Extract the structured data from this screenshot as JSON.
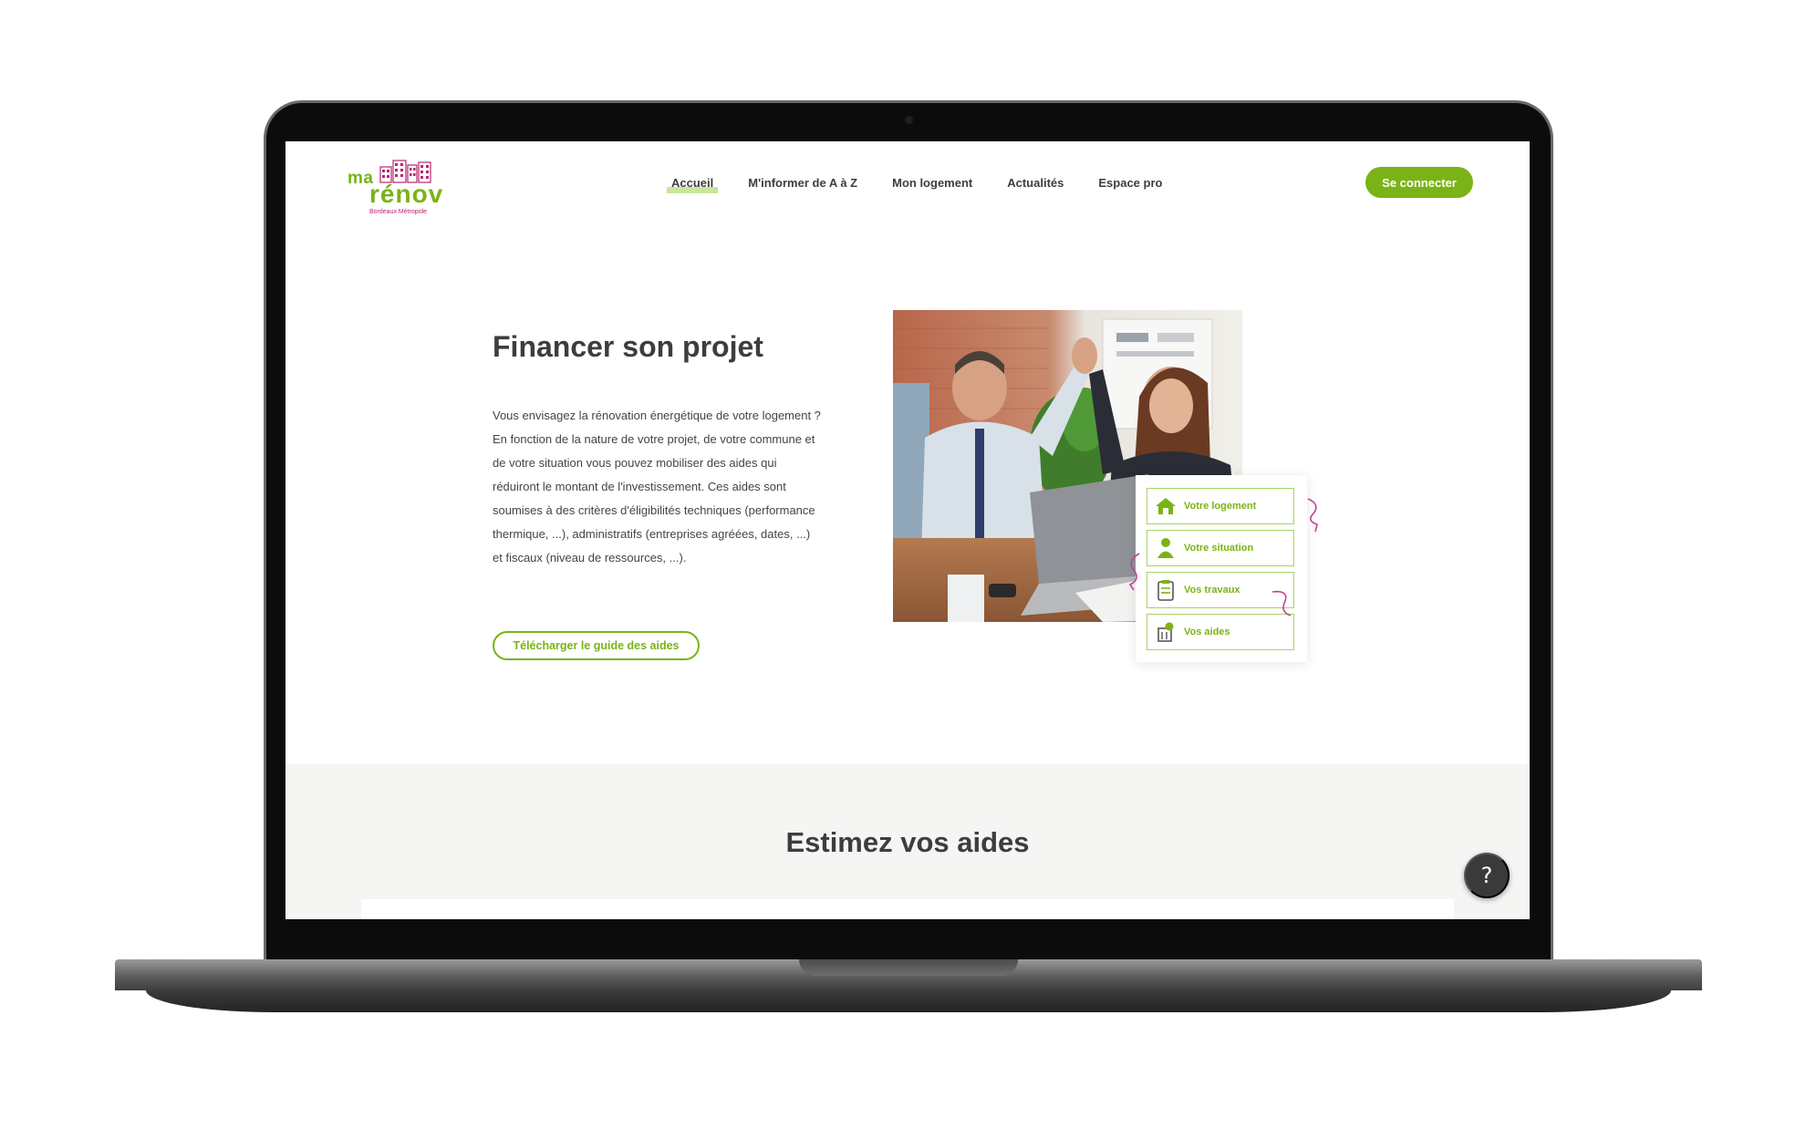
{
  "brand": {
    "logo_top": "ma",
    "logo_main": "rénov",
    "logo_sub": "Bordeaux Métropole",
    "accent_color": "#7ab317",
    "secondary_color": "#b6256d"
  },
  "nav": {
    "items": [
      {
        "label": "Accueil",
        "active": true
      },
      {
        "label": "M'informer de A à Z"
      },
      {
        "label": "Mon logement"
      },
      {
        "label": "Actualités"
      },
      {
        "label": "Espace pro"
      }
    ],
    "login_label": "Se connecter"
  },
  "hero": {
    "title": "Financer son projet",
    "text": "Vous envisagez la rénovation énergétique de votre logement ? En fonction de la nature de votre projet, de votre commune et de votre situation vous pouvez mobiliser des aides qui réduiront le montant de l'investissement. Ces aides sont soumises à des critères d'éligibilités techniques (performance thermique, ...), administratifs (entreprises agréées, dates, ...) et fiscaux (niveau de ressources, ...).",
    "button_label": "Télécharger le guide des aides"
  },
  "steps": [
    {
      "label": "Votre logement",
      "icon": "house-icon"
    },
    {
      "label": "Votre situation",
      "icon": "person-icon"
    },
    {
      "label": "Vos travaux",
      "icon": "clipboard-icon"
    },
    {
      "label": "Vos aides",
      "icon": "money-icon"
    }
  ],
  "estimate": {
    "title": "Estimez vos aides"
  },
  "help": {
    "label": "?"
  }
}
